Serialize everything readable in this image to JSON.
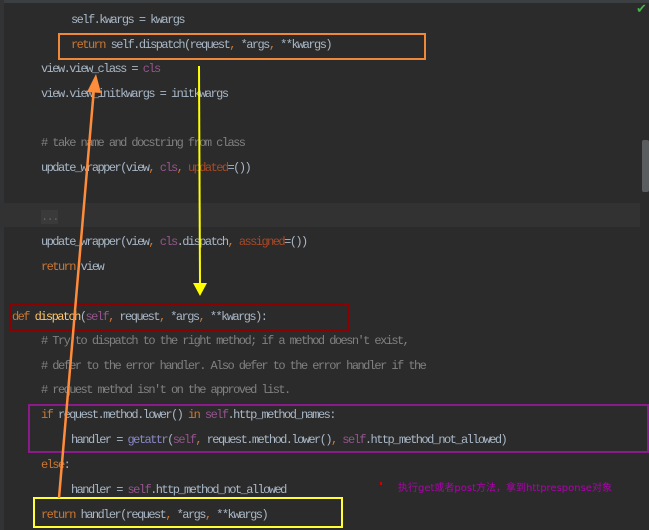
{
  "code_lines": [
    {
      "indent": 2,
      "tokens": [
        {
          "t": "txt",
          "v": "self.kwargs = kwargs"
        }
      ]
    },
    {
      "indent": 2,
      "tokens": [
        {
          "t": "kw",
          "v": "return "
        },
        {
          "t": "txt",
          "v": "self.dispatch(request"
        },
        {
          "t": "kw",
          "v": ", "
        },
        {
          "t": "txt",
          "v": "*args"
        },
        {
          "t": "kw",
          "v": ", "
        },
        {
          "t": "txt",
          "v": "**kwargs)"
        }
      ]
    },
    {
      "indent": 1,
      "tokens": [
        {
          "t": "txt",
          "v": "view.view_class = "
        },
        {
          "t": "self",
          "v": "cls"
        }
      ]
    },
    {
      "indent": 1,
      "tokens": [
        {
          "t": "txt",
          "v": "view.view_initkwargs = initkwargs"
        }
      ]
    },
    {
      "indent": 1,
      "tokens": []
    },
    {
      "indent": 1,
      "tokens": [
        {
          "t": "cm",
          "v": "# take name and docstring from class"
        }
      ]
    },
    {
      "indent": 1,
      "tokens": [
        {
          "t": "txt",
          "v": "update_wrapper(view"
        },
        {
          "t": "kw",
          "v": ", "
        },
        {
          "t": "self",
          "v": "cls"
        },
        {
          "t": "kw",
          "v": ", "
        },
        {
          "t": "param",
          "v": "updated"
        },
        {
          "t": "txt",
          "v": "=())"
        }
      ]
    },
    {
      "indent": 1,
      "tokens": []
    },
    {
      "indent": 1,
      "tokens": [
        {
          "t": "fold",
          "v": "..."
        }
      ]
    },
    {
      "indent": 1,
      "tokens": [
        {
          "t": "txt",
          "v": "update_wrapper(view"
        },
        {
          "t": "kw",
          "v": ", "
        },
        {
          "t": "self",
          "v": "cls"
        },
        {
          "t": "txt",
          "v": ".dispatch"
        },
        {
          "t": "kw",
          "v": ", "
        },
        {
          "t": "param",
          "v": "assigned"
        },
        {
          "t": "txt",
          "v": "=())"
        }
      ]
    },
    {
      "indent": 1,
      "tokens": [
        {
          "t": "kw",
          "v": "return "
        },
        {
          "t": "txt",
          "v": "view"
        }
      ]
    },
    {
      "indent": 0,
      "tokens": []
    },
    {
      "indent": 0,
      "tokens": [
        {
          "t": "kw",
          "v": "def "
        },
        {
          "t": "fn",
          "v": "dispatch"
        },
        {
          "t": "txt",
          "v": "("
        },
        {
          "t": "self",
          "v": "self"
        },
        {
          "t": "kw",
          "v": ", "
        },
        {
          "t": "txt",
          "v": "request"
        },
        {
          "t": "kw",
          "v": ", "
        },
        {
          "t": "txt",
          "v": "*args"
        },
        {
          "t": "kw",
          "v": ", "
        },
        {
          "t": "txt",
          "v": "**kwargs):"
        }
      ]
    },
    {
      "indent": 1,
      "tokens": [
        {
          "t": "cm",
          "v": "# Try to dispatch to the right method; if a method doesn't exist,"
        }
      ]
    },
    {
      "indent": 1,
      "tokens": [
        {
          "t": "cm",
          "v": "# defer to the error handler. Also defer to the error handler if the"
        }
      ]
    },
    {
      "indent": 1,
      "tokens": [
        {
          "t": "cm",
          "v": "# request method isn't on the approved list."
        }
      ]
    },
    {
      "indent": 1,
      "tokens": [
        {
          "t": "kw",
          "v": "if "
        },
        {
          "t": "txt",
          "v": "request.method.lower() "
        },
        {
          "t": "kw",
          "v": "in "
        },
        {
          "t": "self",
          "v": "self"
        },
        {
          "t": "txt",
          "v": ".http_method_names:"
        }
      ]
    },
    {
      "indent": 2,
      "tokens": [
        {
          "t": "txt",
          "v": "handler = "
        },
        {
          "t": "bi",
          "v": "getattr"
        },
        {
          "t": "txt",
          "v": "("
        },
        {
          "t": "self",
          "v": "self"
        },
        {
          "t": "kw",
          "v": ", "
        },
        {
          "t": "txt",
          "v": "request.method.lower()"
        },
        {
          "t": "kw",
          "v": ", "
        },
        {
          "t": "self",
          "v": "self"
        },
        {
          "t": "txt",
          "v": ".http_method_not_allowed)"
        }
      ]
    },
    {
      "indent": 1,
      "tokens": [
        {
          "t": "kw",
          "v": "else"
        },
        {
          "t": "txt",
          "v": ":"
        }
      ]
    },
    {
      "indent": 2,
      "tokens": [
        {
          "t": "txt",
          "v": "handler = "
        },
        {
          "t": "self",
          "v": "self"
        },
        {
          "t": "txt",
          "v": ".http_method_not_allowed"
        }
      ]
    },
    {
      "indent": 1,
      "tokens": [
        {
          "t": "kw",
          "v": "return "
        },
        {
          "t": "txt",
          "v": "handler(request"
        },
        {
          "t": "kw",
          "v": ", "
        },
        {
          "t": "txt",
          "v": "*args"
        },
        {
          "t": "kw",
          "v": ", "
        },
        {
          "t": "txt",
          "v": "**kwargs)"
        }
      ]
    }
  ],
  "annotation": {
    "text": "执行get或者post方法，拿到httpresponse对象"
  },
  "colors": {
    "orange_box": "#f0883a",
    "red_box": "#8b0000",
    "purple_box": "#8b1a8b",
    "yellow_box": "#ffff33",
    "yellow_arrow": "#ffff00",
    "orange_arrow": "#ff8c3a"
  },
  "status": {
    "icon": "check-icon"
  }
}
